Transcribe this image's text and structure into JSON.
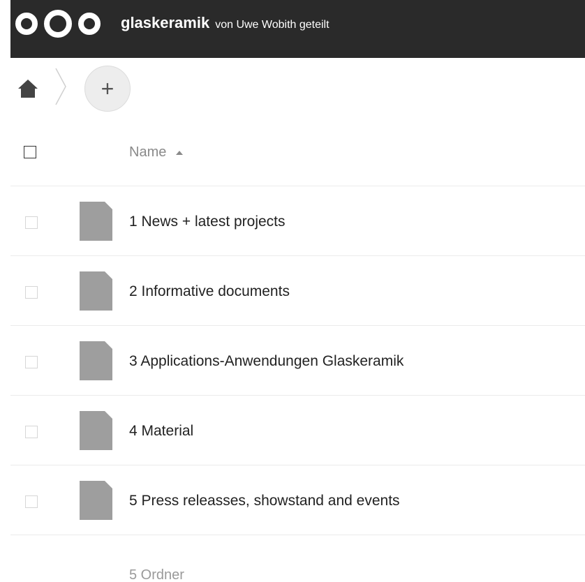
{
  "header": {
    "folder_name": "glaskeramik",
    "shared_by": "von Uwe Wobith geteilt",
    "background": "#2a2a2a",
    "logo_icon": "nextcloud-logo-icon"
  },
  "breadcrumb": {
    "home_icon": "home-icon",
    "add_label": "+"
  },
  "table": {
    "column_name": "Name",
    "sort_icon": "sort-ascending-icon",
    "rows": [
      {
        "name": "1 News + latest projects",
        "icon": "file-icon"
      },
      {
        "name": "2 Informative documents",
        "icon": "file-icon"
      },
      {
        "name": "3 Applications-Anwendungen Glaskeramik",
        "icon": "file-icon"
      },
      {
        "name": "4 Material",
        "icon": "file-icon"
      },
      {
        "name": "5 Press releasses, showstand and events",
        "icon": "file-icon"
      }
    ],
    "summary": "5 Ordner"
  }
}
